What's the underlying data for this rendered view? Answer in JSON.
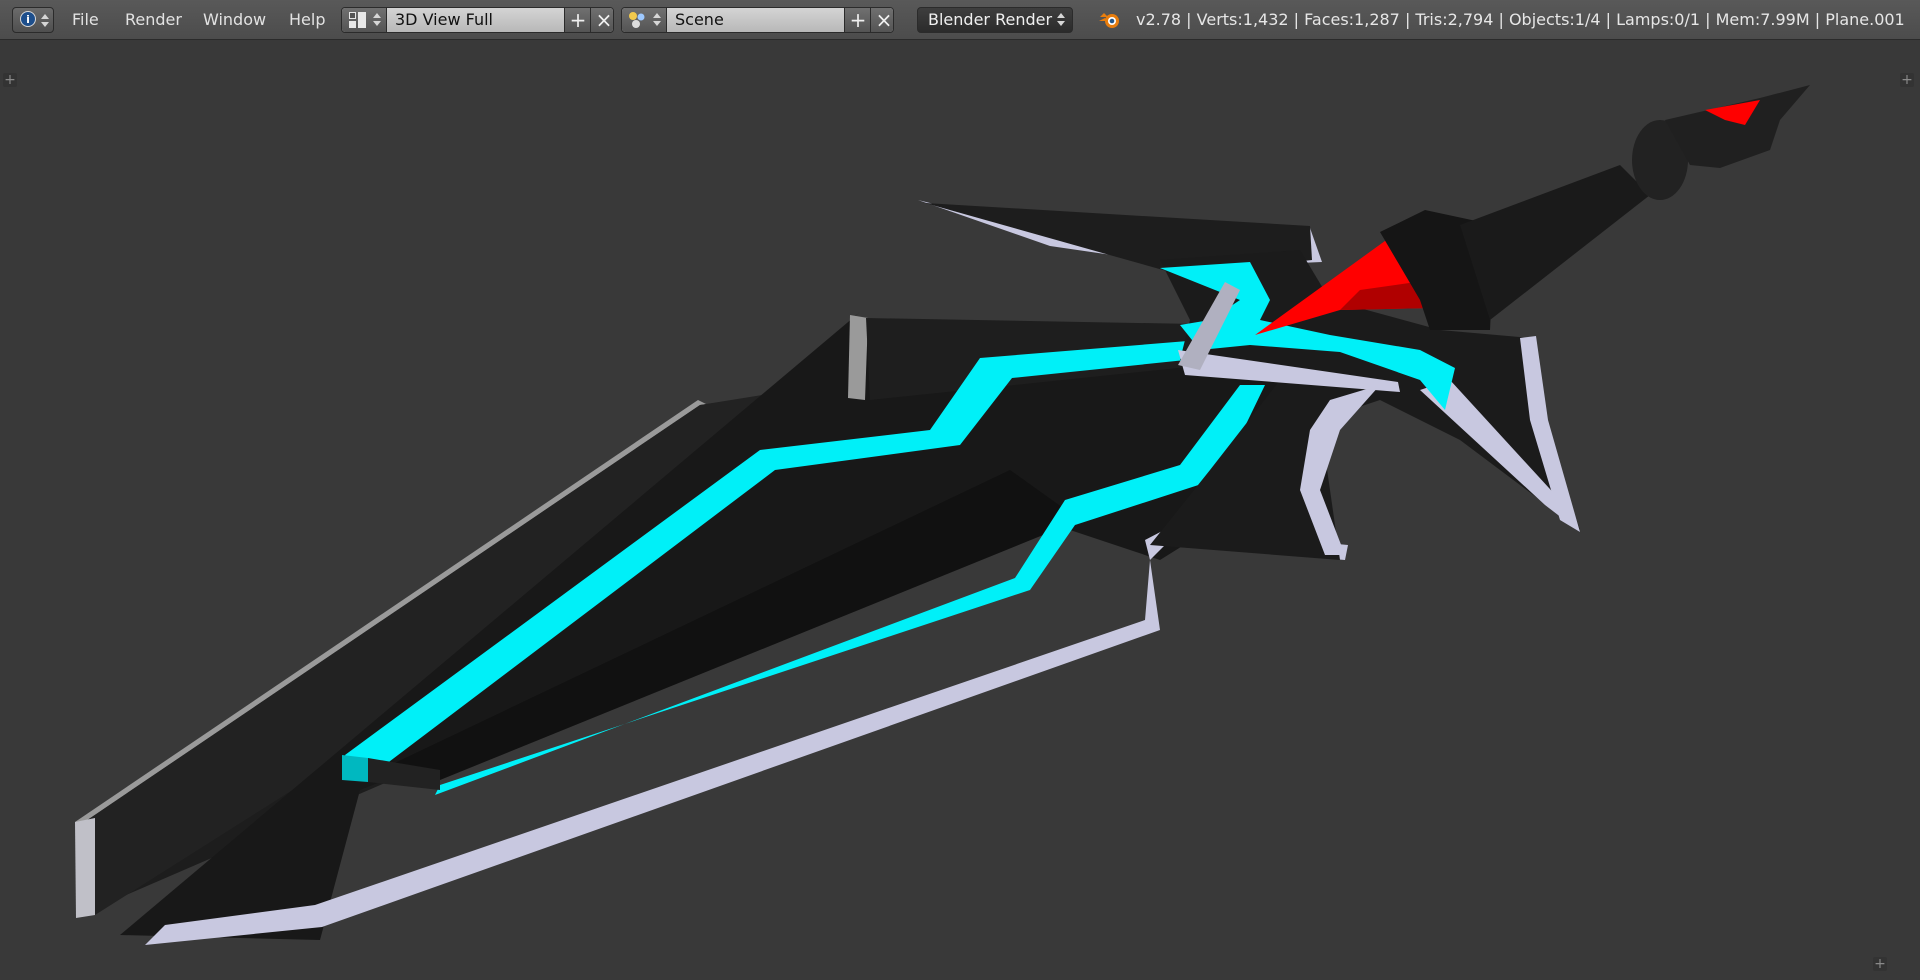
{
  "header": {
    "editor_type_icon": "info-icon",
    "editor_type_glyph": "i",
    "menus": [
      "File",
      "Render",
      "Window",
      "Help"
    ],
    "screen_layout": {
      "icon": "screen-layout-icon",
      "value": "3D View Full",
      "add_label": "+",
      "remove_label": "×"
    },
    "scene": {
      "icon": "scene-icon",
      "value": "Scene",
      "add_label": "+",
      "remove_label": "×"
    },
    "render_engine": "Blender Render",
    "stats": "v2.78 | Verts:1,432 | Faces:1,287 | Tris:2,794 | Objects:1/4 | Lamps:0/1 | Mem:7.99M | Plane.001"
  },
  "viewport": {
    "corner_plus": "+",
    "object": "sword-model",
    "colors": {
      "background": "#393939",
      "blade_dark": "#1b1b1b",
      "edge_light": "#c8c8e0",
      "glow": "#00f0f8",
      "gem": "#ff0000"
    }
  }
}
